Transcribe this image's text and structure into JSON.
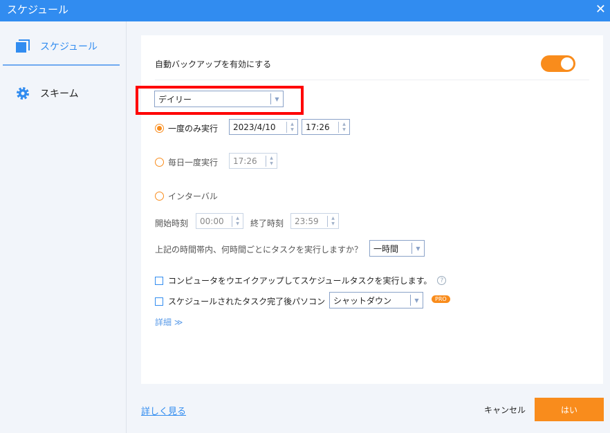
{
  "window": {
    "title": "スケジュール",
    "close": "✕"
  },
  "sidebar": {
    "items": [
      {
        "label": "スケジュール",
        "icon": "copy-icon"
      },
      {
        "label": "スキーム",
        "icon": "gear-icon"
      }
    ]
  },
  "main": {
    "auto_backup_label": "自動バックアップを有効にする",
    "auto_backup_enabled": true,
    "frequency": "デイリー",
    "once_label": "一度のみ実行",
    "once_date": "2023/4/10",
    "once_time": "17:26",
    "daily_label": "毎日一度実行",
    "daily_time": "17:26",
    "interval_label": "インターバル",
    "start_label": "開始時刻",
    "start_time": "00:00",
    "end_label": "終了時刻",
    "end_time": "23:59",
    "interval_question": "上記の時間帯内、何時間ごとにタスクを実行しますか？",
    "interval_value": "一時間",
    "wake_label": "コンピュータをウエイクアップしてスケジュールタスクを実行します。",
    "help": "?",
    "after_label": "スケジュールされたタスク完了後パソコン",
    "after_value": "シャットダウン",
    "pro": "PRO",
    "details": "詳細 ≫"
  },
  "footer": {
    "learn_more": "詳しく見る",
    "cancel": "キャンセル",
    "ok": "はい"
  }
}
